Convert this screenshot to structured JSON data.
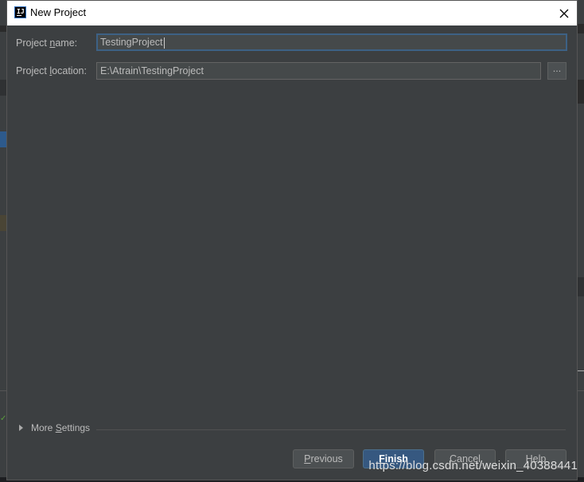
{
  "window": {
    "title": "New Project",
    "app_icon": "intellij-logo",
    "logo_text": "IJ"
  },
  "form": {
    "name_label_prefix": "Project ",
    "name_label_mnemonic": "n",
    "name_label_suffix": "ame:",
    "name_value": "TestingProject",
    "location_label_prefix": "Project ",
    "location_label_mnemonic": "l",
    "location_label_suffix": "ocation:",
    "location_value": "E:\\Atrain\\TestingProject",
    "browse_label": "..."
  },
  "more_settings": {
    "label_prefix": "More ",
    "label_mnemonic": "S",
    "label_suffix": "ettings"
  },
  "buttons": {
    "previous_mnemonic": "P",
    "previous_rest": "revious",
    "finish_mnemonic": "F",
    "finish_rest": "inish",
    "cancel": "Cancel",
    "help": "Help"
  },
  "watermark": "https://blog.csdn.net/weixin_40388441",
  "colors": {
    "accent": "#365880",
    "focus_border": "#3d6185",
    "background": "#3c3f41"
  }
}
